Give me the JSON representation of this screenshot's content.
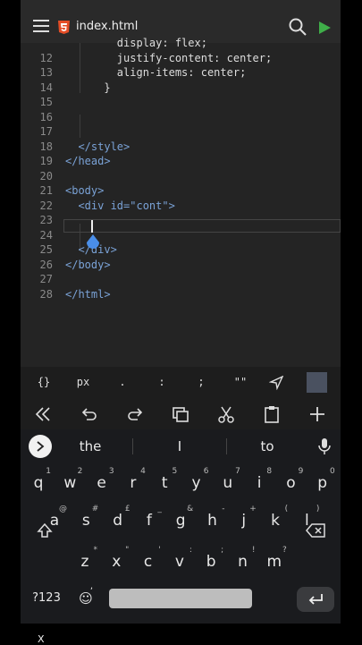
{
  "header": {
    "file_name": "index.html"
  },
  "editor": {
    "lines": [
      {
        "num": "",
        "html": "        display: flex;"
      },
      {
        "num": "12",
        "html": "        justify-content: center;"
      },
      {
        "num": "13",
        "html": "        align-items: center;"
      },
      {
        "num": "14",
        "html": "      }"
      },
      {
        "num": "15",
        "html": ""
      },
      {
        "num": "16",
        "html": ""
      },
      {
        "num": "17",
        "html": ""
      },
      {
        "num": "18",
        "html": "  </style>"
      },
      {
        "num": "19",
        "html": "</head>"
      },
      {
        "num": "20",
        "html": ""
      },
      {
        "num": "21",
        "html": "<body>"
      },
      {
        "num": "22",
        "html": "  <div id=\"cont\">"
      },
      {
        "num": "23",
        "html": ""
      },
      {
        "num": "24",
        "html": ""
      },
      {
        "num": "25",
        "html": "  </div>"
      },
      {
        "num": "26",
        "html": "</body>"
      },
      {
        "num": "27",
        "html": ""
      },
      {
        "num": "28",
        "html": "</html>"
      }
    ]
  },
  "symbols": [
    "{}",
    "px",
    ".",
    ":",
    ";",
    "\"\""
  ],
  "keyboard": {
    "suggestions": [
      "the",
      "I",
      "to"
    ],
    "row1": [
      {
        "k": "q",
        "s": "1"
      },
      {
        "k": "w",
        "s": "2"
      },
      {
        "k": "e",
        "s": "3"
      },
      {
        "k": "r",
        "s": "4"
      },
      {
        "k": "t",
        "s": "5"
      },
      {
        "k": "y",
        "s": "6"
      },
      {
        "k": "u",
        "s": "7"
      },
      {
        "k": "i",
        "s": "8"
      },
      {
        "k": "o",
        "s": "9"
      },
      {
        "k": "p",
        "s": "0"
      }
    ],
    "row2": [
      {
        "k": "a",
        "s": "@"
      },
      {
        "k": "s",
        "s": "#"
      },
      {
        "k": "d",
        "s": "£"
      },
      {
        "k": "f",
        "s": "_"
      },
      {
        "k": "g",
        "s": "&"
      },
      {
        "k": "h",
        "s": "-"
      },
      {
        "k": "j",
        "s": "+"
      },
      {
        "k": "k",
        "s": "("
      },
      {
        "k": "l",
        "s": ")"
      }
    ],
    "row3": [
      {
        "k": "z",
        "s": "*"
      },
      {
        "k": "x",
        "s": "\""
      },
      {
        "k": "c",
        "s": "'"
      },
      {
        "k": "v",
        "s": ":"
      },
      {
        "k": "b",
        "s": ";"
      },
      {
        "k": "n",
        "s": "!"
      },
      {
        "k": "m",
        "s": "?"
      }
    ],
    "num_label": "?123",
    "emoji_label": "☺",
    "comma_label": ","
  },
  "footer": {
    "close_label": "X"
  }
}
